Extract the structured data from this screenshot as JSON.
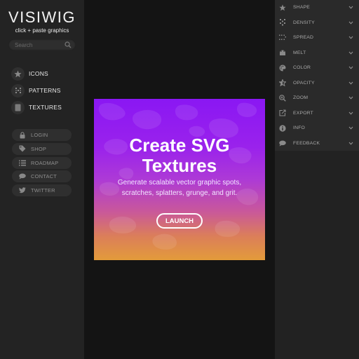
{
  "brand": {
    "logo": "VISIWIG",
    "tagline": "click + paste graphics"
  },
  "search": {
    "placeholder": "Search",
    "value": "",
    "icon": "search-icon"
  },
  "nav": [
    {
      "label": "ICONS",
      "icon": "star-icon"
    },
    {
      "label": "PATTERNS",
      "icon": "pattern-icon"
    },
    {
      "label": "TEXTURES",
      "icon": "texture-icon"
    }
  ],
  "links": [
    {
      "label": "LOGIN",
      "icon": "lock-icon"
    },
    {
      "label": "SHOP",
      "icon": "tag-icon"
    },
    {
      "label": "ROADMAP",
      "icon": "list-icon"
    },
    {
      "label": "CONTACT",
      "icon": "chat-icon"
    },
    {
      "label": "TWITTER",
      "icon": "twitter-icon"
    }
  ],
  "hero": {
    "title_line1": "Create SVG",
    "title_line2": "Textures",
    "subtitle_line1": "Generate scalable vector graphic spots,",
    "subtitle_line2": "scratches, splatters, grunge, and grit.",
    "button": "LAUNCH",
    "gradient_top": "#8a17f3",
    "gradient_bottom": "#e39b3a"
  },
  "panel": [
    {
      "label": "SHAPE",
      "icon": "star-icon"
    },
    {
      "label": "DENSITY",
      "icon": "density-icon"
    },
    {
      "label": "SPREAD",
      "icon": "spread-icon"
    },
    {
      "label": "MELT",
      "icon": "melt-icon"
    },
    {
      "label": "COLOR",
      "icon": "palette-icon"
    },
    {
      "label": "OPACITY",
      "icon": "opacity-star-icon"
    },
    {
      "label": "ZOOM",
      "icon": "zoom-icon"
    },
    {
      "label": "EXPORT",
      "icon": "export-icon"
    },
    {
      "label": "INFO",
      "icon": "info-icon"
    },
    {
      "label": "FEEDBACK",
      "icon": "feedback-icon"
    }
  ]
}
